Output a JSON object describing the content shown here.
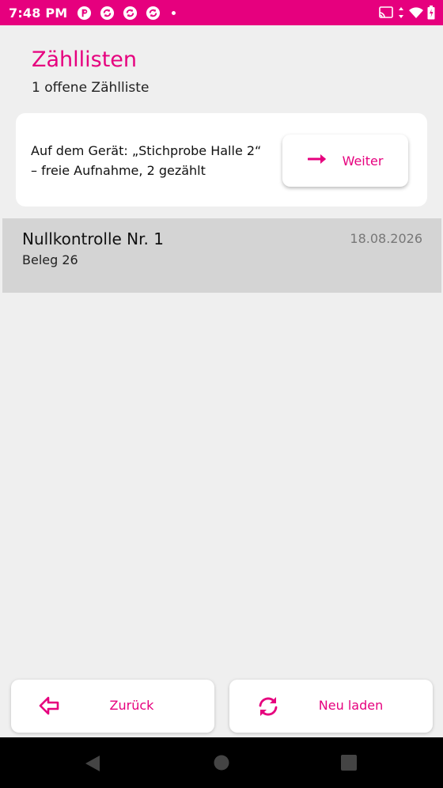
{
  "status_bar": {
    "time": "7:48 PM",
    "notification_icons": [
      "app-icon",
      "sync-icon",
      "sync-icon",
      "sync-icon"
    ],
    "system_icons": [
      "cast-icon",
      "data-arrows-icon",
      "wifi-icon",
      "battery-charging-icon"
    ]
  },
  "header": {
    "title": "Zähllisten",
    "subtitle": "1 offene Zählliste"
  },
  "resume_card": {
    "text_line1": "Auf dem Gerät: „Stichprobe Halle 2“",
    "text_line2": "– freie Aufnahme, 2 gezählt",
    "button_label": "Weiter"
  },
  "list": {
    "items": [
      {
        "title": "Nullkontrolle Nr. 1",
        "subtitle": "Beleg 26",
        "date": "18.08.2026"
      }
    ]
  },
  "footer": {
    "back_label": "Zurück",
    "reload_label": "Neu laden"
  },
  "colors": {
    "accent": "#e6007e",
    "background": "#efefef",
    "list_item_bg": "#d4d4d4"
  }
}
